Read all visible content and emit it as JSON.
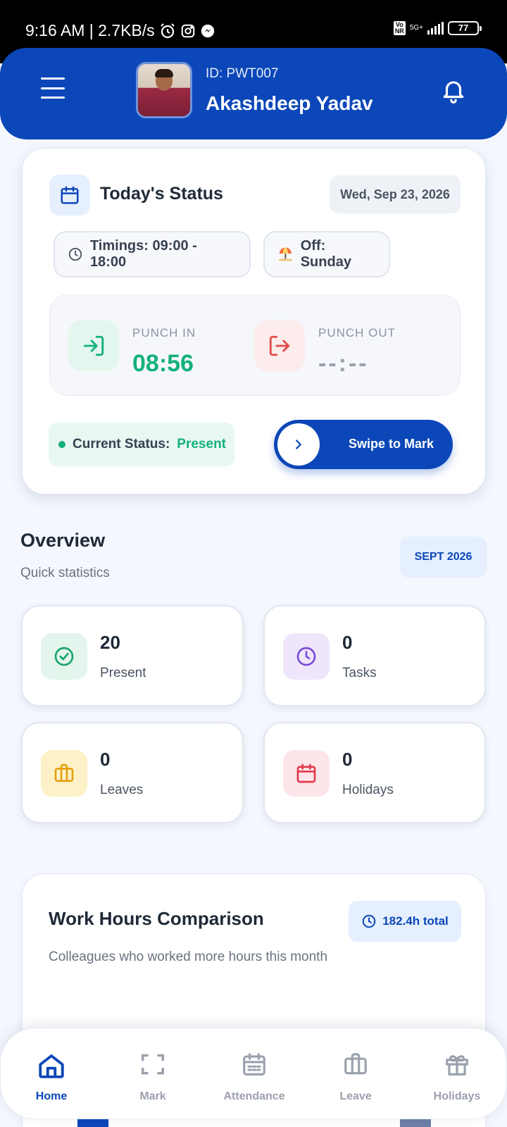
{
  "status_bar": {
    "time_speed": "9:16 AM | 2.7KB/s",
    "volte": "Vo\nNR",
    "network": "5G+",
    "battery": "77"
  },
  "header": {
    "user_id": "ID: PWT007",
    "user_name": "Akashdeep Yadav"
  },
  "today": {
    "title": "Today's Status",
    "date": "Wed, Sep 23, 2026",
    "timings": "Timings: 09:00 - 18:00",
    "off_day": "Off: Sunday",
    "punch_in_label": "PUNCH IN",
    "punch_in_time": "08:56",
    "punch_out_label": "PUNCH OUT",
    "punch_out_time": "--:--",
    "current_status_label": "Current Status:",
    "current_status_value": "Present",
    "swipe_label": "Swipe to Mark"
  },
  "overview": {
    "title": "Overview",
    "subtitle": "Quick statistics",
    "month": "SEPT 2026",
    "stats": [
      {
        "value": "20",
        "label": "Present",
        "icon": "check-circle-icon",
        "color": "#1aa56b"
      },
      {
        "value": "0",
        "label": "Tasks",
        "icon": "clock-icon",
        "color": "#7c4ddb"
      },
      {
        "value": "0",
        "label": "Leaves",
        "icon": "briefcase-icon",
        "color": "#e4a012"
      },
      {
        "value": "0",
        "label": "Holidays",
        "icon": "calendar-icon",
        "color": "#e2384d"
      }
    ]
  },
  "work_hours": {
    "title": "Work Hours Comparison",
    "subtitle": "Colleagues who worked more hours this month",
    "total": "182.4h total"
  },
  "nav": {
    "items": [
      {
        "label": "Home",
        "icon": "home-icon"
      },
      {
        "label": "Mark",
        "icon": "scan-icon"
      },
      {
        "label": "Attendance",
        "icon": "calendar-icon"
      },
      {
        "label": "Leave",
        "icon": "briefcase-icon"
      },
      {
        "label": "Holidays",
        "icon": "gift-icon"
      }
    ],
    "active": "Home"
  },
  "colors": {
    "primary": "#0b47b8",
    "success": "#13b07a",
    "danger": "#e24b4b"
  }
}
